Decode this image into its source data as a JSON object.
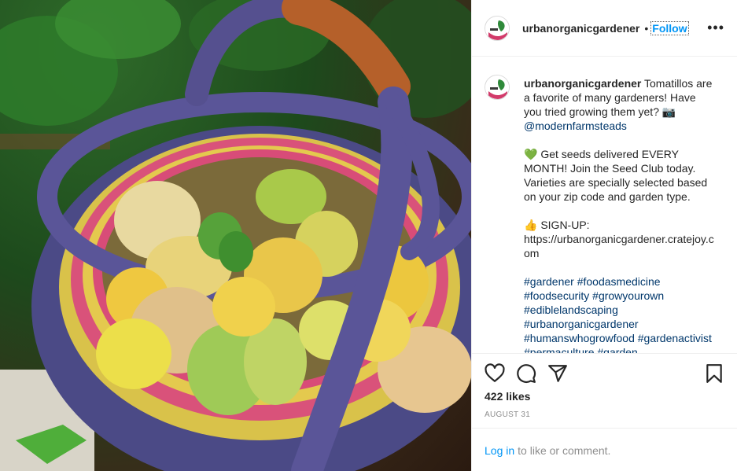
{
  "photo": {
    "alt_subject": "tomatillos-in-basket"
  },
  "post_header": {
    "username": "urbanorganicgardener",
    "separator": "•",
    "follow_label": "Follow",
    "more_icon": "more-options-icon"
  },
  "caption": {
    "username": "urbanorganicgardener",
    "text_part1": " Tomatillos are a favorite of many gardeners! Have you tried growing them yet? 📷",
    "mention": "@modernfarmsteads",
    "text_part2": "💚 Get seeds delivered EVERY MONTH! Join the Seed Club today. Varieties are specially selected based on your zip code and garden type.",
    "text_part3": "👍 SIGN-UP:",
    "signup_url": "https://urbanorganicgardener.cratejoy.com",
    "hashtags": "#gardener #foodasmedicine #foodsecurity #growyourown #ediblelandscaping #urbanorganicgardener #humanswhogrowfood #gardenactivist #permaculture #garden"
  },
  "actions": {
    "like_icon": "heart-icon",
    "comment_icon": "comment-icon",
    "share_icon": "share-icon",
    "save_icon": "bookmark-icon",
    "likes_text": "422 likes",
    "date_text": "AUGUST 31"
  },
  "login_bar": {
    "login_label": "Log in",
    "rest_text": "to like or comment."
  },
  "colors": {
    "link_blue": "#0095f6",
    "mention_blue": "#00376b",
    "muted_gray": "#8e8e8e",
    "border": "#efefef"
  }
}
